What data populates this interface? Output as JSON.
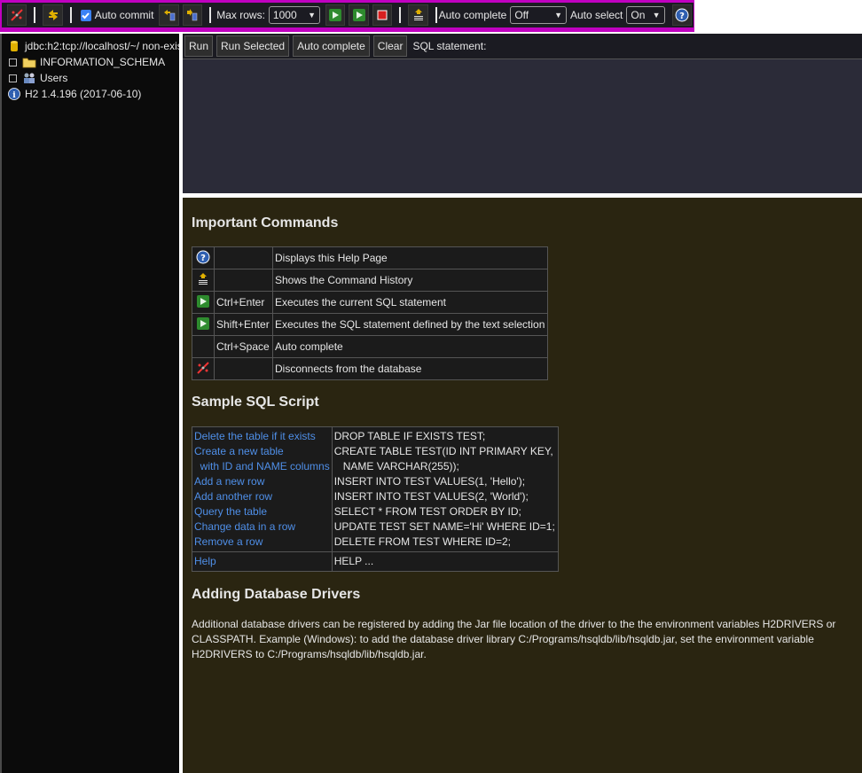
{
  "toolbar": {
    "auto_commit_label": "Auto commit",
    "auto_commit_checked": true,
    "max_rows_label": "Max rows:",
    "max_rows_value": "1000",
    "auto_complete_label": "Auto complete",
    "auto_complete_value": "Off",
    "auto_select_label": "Auto select",
    "auto_select_value": "On",
    "accent_color": "#c000c0"
  },
  "tree": {
    "connection": "jdbc:h2:tcp://localhost/~/ non-exis",
    "schema": "INFORMATION_SCHEMA",
    "users": "Users",
    "version": "H2 1.4.196 (2017-06-10)"
  },
  "query_bar": {
    "run": "Run",
    "run_selected": "Run Selected",
    "auto_complete": "Auto complete",
    "clear": "Clear",
    "sql_label": "SQL statement:"
  },
  "help": {
    "important_title": "Important Commands",
    "commands": [
      {
        "icon": "help-icon",
        "key": "",
        "desc": "Displays this Help Page"
      },
      {
        "icon": "history-icon",
        "key": "",
        "desc": "Shows the Command History"
      },
      {
        "icon": "run-icon",
        "key": "Ctrl+Enter",
        "desc": "Executes the current SQL statement"
      },
      {
        "icon": "run-selected-icon",
        "key": "Shift+Enter",
        "desc": "Executes the SQL statement defined by the text selection"
      },
      {
        "icon": "",
        "key": "Ctrl+Space",
        "desc": "Auto complete"
      },
      {
        "icon": "disconnect-icon",
        "key": "",
        "desc": "Disconnects from the database"
      }
    ],
    "sample_title": "Sample SQL Script",
    "sample_links": [
      "Delete the table if it exists",
      "Create a new table",
      "  with ID and NAME columns",
      "Add a new row",
      "Add another row",
      "Query the table",
      "Change data in a row",
      "Remove a row"
    ],
    "sample_sql": [
      "DROP TABLE IF EXISTS TEST;",
      "CREATE TABLE TEST(ID INT PRIMARY KEY,",
      "   NAME VARCHAR(255));",
      "INSERT INTO TEST VALUES(1, 'Hello');",
      "INSERT INTO TEST VALUES(2, 'World');",
      "SELECT * FROM TEST ORDER BY ID;",
      "UPDATE TEST SET NAME='Hi' WHERE ID=1;",
      "DELETE FROM TEST WHERE ID=2;"
    ],
    "help_link": "Help",
    "help_sql": "HELP ...",
    "drivers_title": "Adding Database Drivers",
    "drivers_text": "Additional database drivers can be registered by adding the Jar file location of the driver to the the environment variables H2DRIVERS or CLASSPATH. Example (Windows): to add the database driver library C:/Programs/hsqldb/lib/hsqldb.jar, set the environment variable H2DRIVERS to C:/Programs/hsqldb/lib/hsqldb.jar."
  }
}
